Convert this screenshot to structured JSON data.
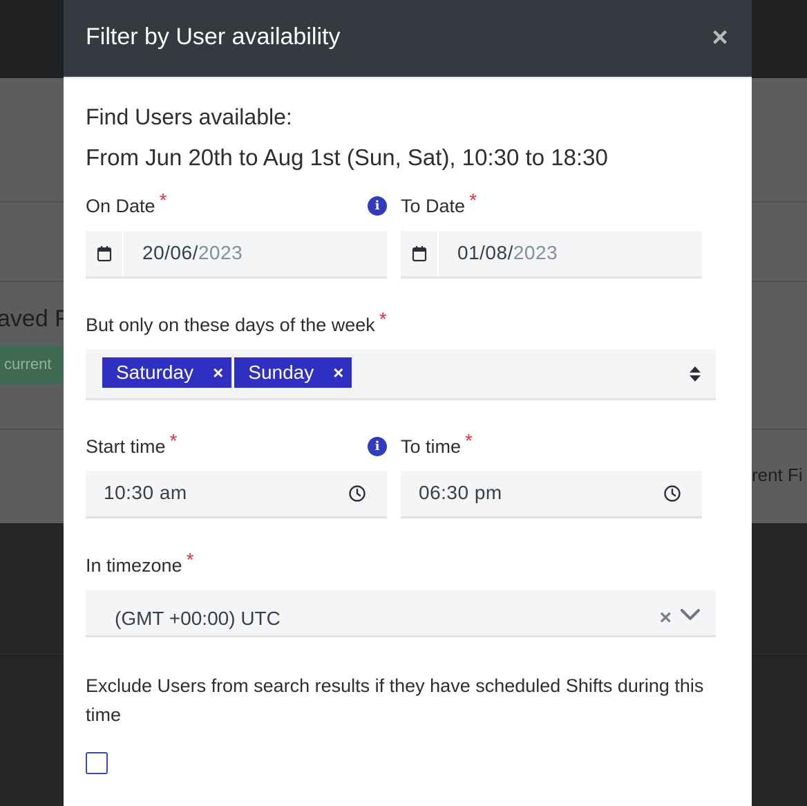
{
  "background": {
    "saved_text": "aved F",
    "current_badge": "current",
    "current_text": "rent Fi"
  },
  "modal": {
    "title": "Filter by User availability",
    "close_label": "×"
  },
  "summary": {
    "heading": "Find Users available:",
    "text": "From Jun 20th to Aug 1st (Sun, Sat), 10:30 to 18:30"
  },
  "on_date": {
    "label": "On Date",
    "required": "*",
    "value_day_month": "20/06/",
    "value_year": "2023"
  },
  "to_date": {
    "label": "To Date",
    "required": "*",
    "value_day_month": "01/08/",
    "value_year": "2023"
  },
  "days": {
    "label": "But only on these days of the week",
    "required": "*",
    "selected": [
      "Saturday",
      "Sunday"
    ],
    "remove_label": "×"
  },
  "start_time": {
    "label": "Start time",
    "required": "*",
    "value": "10:30  am"
  },
  "to_time": {
    "label": "To time",
    "required": "*",
    "value": "06:30  pm"
  },
  "info_icon_glyph": "i",
  "timezone": {
    "label": "In timezone",
    "required": "*",
    "value": "(GMT +00:00) UTC",
    "clear_label": "×"
  },
  "exclude": {
    "text": "Exclude Users from search results if they have scheduled Shifts during this time",
    "checked": false
  },
  "colors": {
    "header_bg": "#343a40",
    "tag_bg": "#2f2fc2",
    "required": "#dc3545",
    "info_icon": "#2f3cc0"
  }
}
